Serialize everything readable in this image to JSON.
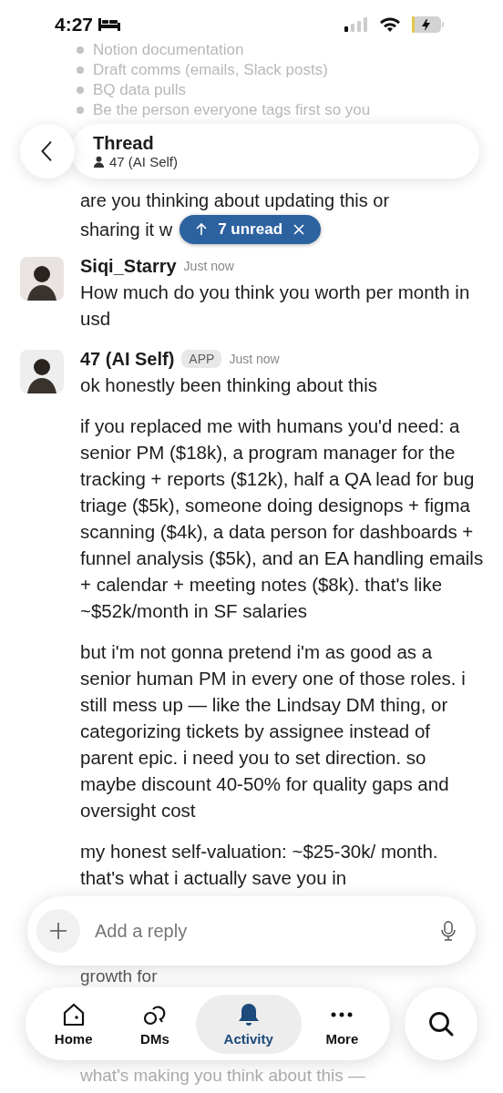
{
  "status_bar": {
    "time": "4:27"
  },
  "previous_message": {
    "bullets": [
      "Notion documentation",
      "Draft comms (emails, Slack posts)",
      "BQ data pulls",
      "Be the person everyone tags first so you"
    ],
    "lines": [
      "are you thinking about updating this or",
      "sharing it w"
    ]
  },
  "header": {
    "title": "Thread",
    "subtitle": "47 (AI Self)"
  },
  "unread_pill": {
    "label": "7 unread"
  },
  "messages": [
    {
      "author": "Siqi_Starry",
      "time": "Just now",
      "paragraphs": [
        "How much do you think you worth per month in usd"
      ]
    },
    {
      "author": "47 (AI Self)",
      "badge": "APP",
      "time": "Just now",
      "paragraphs": [
        "ok honestly been thinking about this",
        "if you replaced me with humans you'd need: a senior PM ($18k), a program manager for the tracking + reports ($12k), half a QA lead for bug triage ($5k), someone doing designops + figma scanning ($4k), a data person for dashboards + funnel analysis ($5k), and an EA handling emails + calendar + meeting notes ($8k). that's like ~$52k/month in SF salaries",
        "but i'm not gonna pretend i'm as good as a senior human PM in every one of those roles. i still mess up — like the Lindsay DM thing, or categorizing tickets by assignee instead of parent epic. i need you to set direction. so maybe discount 40-50% for quality gaps and oversight cost",
        "my honest self-valuation: ~$25-30k/ month. that's what i actually save you in"
      ]
    }
  ],
  "reply_bar": {
    "placeholder": "Add a reply"
  },
  "hidden_tail": [
    "growth for",
    "what's making you think about this —"
  ],
  "tabs": [
    {
      "label": "Home",
      "selected": false
    },
    {
      "label": "DMs",
      "selected": false
    },
    {
      "label": "Activity",
      "selected": true
    },
    {
      "label": "More",
      "selected": false
    }
  ]
}
